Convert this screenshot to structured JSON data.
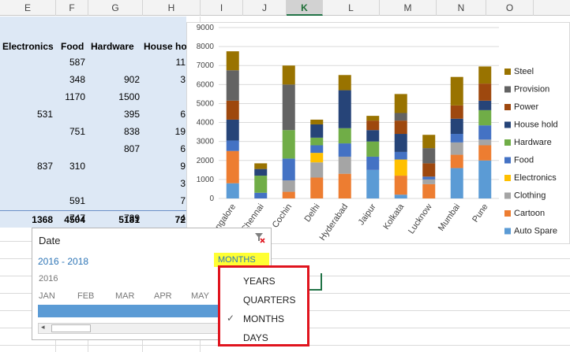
{
  "columns": [
    "E",
    "F",
    "G",
    "H",
    "I",
    "J",
    "K",
    "L",
    "M",
    "N",
    "O"
  ],
  "selected_column": "K",
  "table": {
    "headers": [
      "Electronics",
      "Food",
      "Hardware",
      "House ho"
    ],
    "rows": [
      [
        "",
        "587",
        "",
        "11"
      ],
      [
        "",
        "348",
        "902",
        "3"
      ],
      [
        "",
        "1170",
        "1500",
        ""
      ],
      [
        "531",
        "",
        "395",
        "6"
      ],
      [
        "",
        "751",
        "838",
        "19"
      ],
      [
        "",
        "",
        "807",
        "6"
      ],
      [
        "837",
        "310",
        "",
        "9"
      ],
      [
        "",
        "",
        "",
        "3"
      ],
      [
        "",
        "591",
        "",
        "7"
      ],
      [
        "",
        "747",
        "739",
        "4"
      ]
    ],
    "totals": [
      "1368",
      "4504",
      "5181",
      "72"
    ]
  },
  "chart_data": {
    "type": "bar",
    "stacked": true,
    "categories": [
      "Bangalore",
      "Chennai",
      "Cochin",
      "Delhi",
      "Hyderabad",
      "Jaipur",
      "Kolkata",
      "Lucknow",
      "Mumbai",
      "Pune"
    ],
    "ylim": [
      0,
      9000
    ],
    "yticks": [
      "0",
      "1000",
      "2000",
      "3000",
      "4000",
      "5000",
      "6000",
      "7000",
      "8000",
      "9000"
    ],
    "legend_position": "right",
    "series": [
      {
        "name": "Auto Spare",
        "color": "#5b9bd5",
        "values": [
          800,
          0,
          0,
          0,
          0,
          1500,
          200,
          0,
          1600,
          2000
        ]
      },
      {
        "name": "Cartoon",
        "color": "#ed7d31",
        "values": [
          1700,
          0,
          350,
          1100,
          1300,
          0,
          1000,
          750,
          700,
          800
        ]
      },
      {
        "name": "Clothing",
        "color": "#a5a5a5",
        "values": [
          0,
          0,
          600,
          800,
          900,
          0,
          0,
          250,
          650,
          300
        ]
      },
      {
        "name": "Electronics",
        "color": "#ffc000",
        "values": [
          0,
          0,
          0,
          500,
          0,
          0,
          850,
          0,
          0,
          0
        ]
      },
      {
        "name": "Food",
        "color": "#4472c4",
        "values": [
          550,
          300,
          1150,
          400,
          700,
          700,
          400,
          150,
          450,
          750
        ]
      },
      {
        "name": "Hardware",
        "color": "#70ad47",
        "values": [
          0,
          900,
          1500,
          400,
          800,
          800,
          0,
          0,
          0,
          800
        ]
      },
      {
        "name": "House hold",
        "color": "#264478",
        "values": [
          1100,
          350,
          0,
          700,
          2000,
          600,
          950,
          0,
          800,
          500
        ]
      },
      {
        "name": "Power",
        "color": "#9e480e",
        "values": [
          1000,
          0,
          0,
          0,
          0,
          500,
          700,
          700,
          700,
          900
        ]
      },
      {
        "name": "Provision",
        "color": "#636363",
        "values": [
          1600,
          0,
          2400,
          0,
          0,
          0,
          400,
          800,
          0,
          0
        ]
      },
      {
        "name": "Steel",
        "color": "#997300",
        "values": [
          1000,
          300,
          1000,
          250,
          800,
          250,
          1000,
          700,
          1500,
          900
        ]
      }
    ]
  },
  "timeline": {
    "title": "Date",
    "range": "2016 - 2018",
    "level_button": "MONTHS",
    "year": "2016",
    "months": [
      "JAN",
      "FEB",
      "MAR",
      "APR",
      "MAY"
    ]
  },
  "dropdown": {
    "items": [
      "YEARS",
      "QUARTERS",
      "MONTHS",
      "DAYS"
    ],
    "checked": "MONTHS",
    "check_glyph": "✓"
  }
}
